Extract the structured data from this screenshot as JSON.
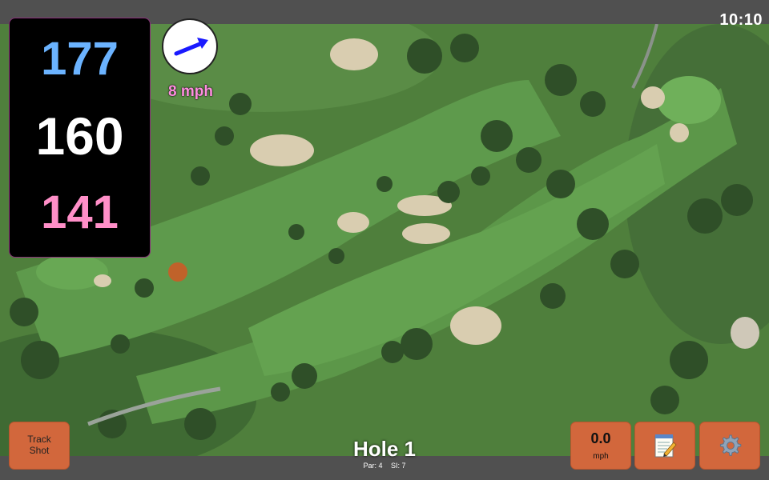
{
  "status_bar": {
    "time": "10:10"
  },
  "distances": {
    "back": "177",
    "middle": "160",
    "front": "141",
    "colors": {
      "back": "#6bb3ff",
      "middle": "#ffffff",
      "front": "#ff8fc8"
    }
  },
  "wind": {
    "speed": "8 mph",
    "arrow_color": "#1a1aff",
    "icon": "wind-arrow-icon"
  },
  "buttons": {
    "track_shot": {
      "line1": "Track",
      "line2": "Shot"
    },
    "speed": {
      "value": "0.0",
      "unit": "mph"
    },
    "notes": {
      "icon": "notepad-icon"
    },
    "settings": {
      "icon": "gear-icon"
    }
  },
  "hole": {
    "title": "Hole 1",
    "par": "Par: 4",
    "si": "SI: 7"
  },
  "colors": {
    "accent": "#d2673c",
    "panel_border": "#8a2f7a",
    "bars": "#505050"
  }
}
